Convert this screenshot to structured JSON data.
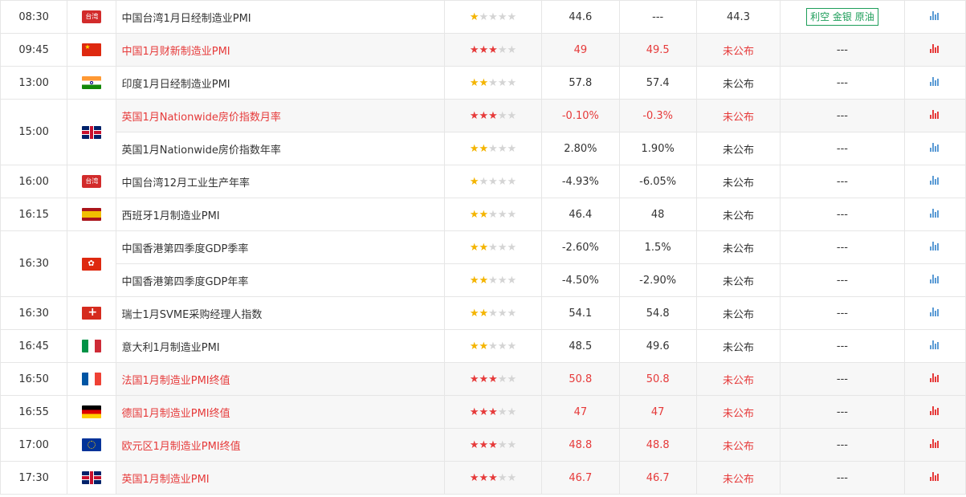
{
  "colors": {
    "important_red": "#e63a3a",
    "star_yellow": "#f4b400",
    "tag_green": "#1e9e5a",
    "chart_blue": "#5b9bd5"
  },
  "flags": {
    "tw": {
      "icon": "taiwan-flag-icon",
      "label": "台湾"
    },
    "cn": {
      "icon": "china-flag-icon"
    },
    "in": {
      "icon": "india-flag-icon"
    },
    "gb": {
      "icon": "uk-flag-icon"
    },
    "es": {
      "icon": "spain-flag-icon"
    },
    "hk": {
      "icon": "hongkong-flag-icon"
    },
    "ch": {
      "icon": "switzerland-flag-icon"
    },
    "it": {
      "icon": "italy-flag-icon"
    },
    "fr": {
      "icon": "france-flag-icon"
    },
    "de": {
      "icon": "germany-flag-icon"
    },
    "eu": {
      "icon": "eurozone-flag-icon"
    }
  },
  "rows": [
    {
      "time": "08:30",
      "name": "中国台湾1月日经制造业PMI",
      "stars": 1,
      "important": false,
      "previous": "44.6",
      "forecast": "---",
      "actual": "44.3",
      "impact": "利空 金银 原油"
    },
    {
      "time": "09:45",
      "name": "中国1月财新制造业PMI",
      "stars": 3,
      "important": true,
      "previous": "49",
      "forecast": "49.5",
      "actual": "未公布",
      "impact": "---"
    },
    {
      "time": "13:00",
      "name": "印度1月日经制造业PMI",
      "stars": 2,
      "important": false,
      "previous": "57.8",
      "forecast": "57.4",
      "actual": "未公布",
      "impact": "---"
    },
    {
      "time": "15:00",
      "name": "英国1月Nationwide房价指数月率",
      "stars": 3,
      "important": true,
      "previous": "-0.10%",
      "forecast": "-0.3%",
      "actual": "未公布",
      "impact": "---"
    },
    {
      "time": "",
      "name": "英国1月Nationwide房价指数年率",
      "stars": 2,
      "important": false,
      "previous": "2.80%",
      "forecast": "1.90%",
      "actual": "未公布",
      "impact": "---"
    },
    {
      "time": "16:00",
      "name": "中国台湾12月工业生产年率",
      "stars": 1,
      "important": false,
      "previous": "-4.93%",
      "forecast": "-6.05%",
      "actual": "未公布",
      "impact": "---"
    },
    {
      "time": "16:15",
      "name": "西班牙1月制造业PMI",
      "stars": 2,
      "important": false,
      "previous": "46.4",
      "forecast": "48",
      "actual": "未公布",
      "impact": "---"
    },
    {
      "time": "16:30",
      "name": "中国香港第四季度GDP季率",
      "stars": 2,
      "important": false,
      "previous": "-2.60%",
      "forecast": "1.5%",
      "actual": "未公布",
      "impact": "---"
    },
    {
      "time": "",
      "name": "中国香港第四季度GDP年率",
      "stars": 2,
      "important": false,
      "previous": "-4.50%",
      "forecast": "-2.90%",
      "actual": "未公布",
      "impact": "---"
    },
    {
      "time": "16:30",
      "name": "瑞士1月SVME采购经理人指数",
      "stars": 2,
      "important": false,
      "previous": "54.1",
      "forecast": "54.8",
      "actual": "未公布",
      "impact": "---"
    },
    {
      "time": "16:45",
      "name": "意大利1月制造业PMI",
      "stars": 2,
      "important": false,
      "previous": "48.5",
      "forecast": "49.6",
      "actual": "未公布",
      "impact": "---"
    },
    {
      "time": "16:50",
      "name": "法国1月制造业PMI终值",
      "stars": 3,
      "important": true,
      "previous": "50.8",
      "forecast": "50.8",
      "actual": "未公布",
      "impact": "---"
    },
    {
      "time": "16:55",
      "name": "德国1月制造业PMI终值",
      "stars": 3,
      "important": true,
      "previous": "47",
      "forecast": "47",
      "actual": "未公布",
      "impact": "---"
    },
    {
      "time": "17:00",
      "name": "欧元区1月制造业PMI终值",
      "stars": 3,
      "important": true,
      "previous": "48.8",
      "forecast": "48.8",
      "actual": "未公布",
      "impact": "---"
    },
    {
      "time": "17:30",
      "name": "英国1月制造业PMI",
      "stars": 3,
      "important": true,
      "previous": "46.7",
      "forecast": "46.7",
      "actual": "未公布",
      "impact": "---"
    }
  ]
}
